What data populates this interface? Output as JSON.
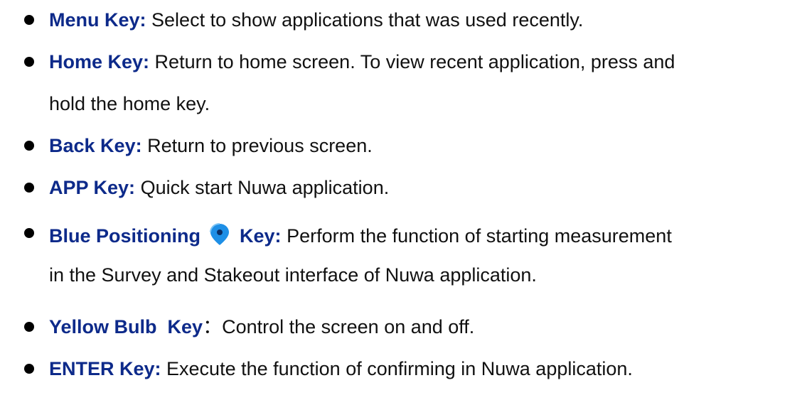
{
  "items": [
    {
      "label": "Menu Key:",
      "text": " Select to show applications that was used recently."
    },
    {
      "label": "Home Key:",
      "text": " Return to home screen. To view recent application, press and",
      "text2": "hold the home key."
    },
    {
      "label": "Back Key:",
      "text": " Return to previous screen."
    },
    {
      "label": "APP Key:",
      "text": " Quick start Nuwa application."
    },
    {
      "label": "Blue Positioning",
      "label_b": "Key:",
      "text": " Perform the function of starting measurement",
      "text2": "in the Survey and Stakeout interface of Nuwa application."
    },
    {
      "label": "Yellow Bulb",
      "label_b": "Key",
      "sep": "：",
      "text": "Control the screen on and off."
    },
    {
      "label": "ENTER Key:",
      "text": " Execute the function of confirming in Nuwa application."
    }
  ],
  "colors": {
    "label": "#0d2a8a",
    "text": "#111111",
    "pin": "#1e8fe6"
  },
  "icons": [
    "bullet-icon",
    "location-pin-icon"
  ]
}
